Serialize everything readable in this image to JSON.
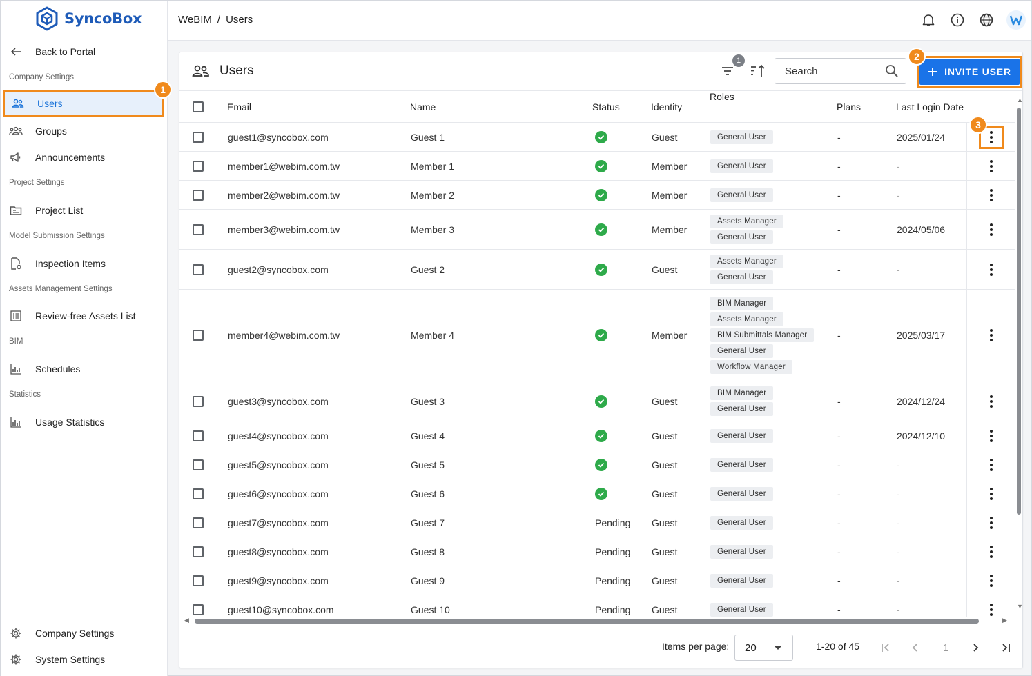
{
  "app": {
    "name": "SyncoBox"
  },
  "sidebar": {
    "back_label": "Back to Portal",
    "sections": {
      "company": "Company Settings",
      "project": "Project Settings",
      "model": "Model Submission Settings",
      "assets": "Assets Management Settings",
      "bim": "BIM",
      "stats": "Statistics"
    },
    "items": {
      "users": "Users",
      "groups": "Groups",
      "announcements": "Announcements",
      "project_list": "Project List",
      "inspection_items": "Inspection Items",
      "review_free": "Review-free Assets List",
      "schedules": "Schedules",
      "usage_statistics": "Usage Statistics"
    },
    "bottom": {
      "company_settings": "Company Settings",
      "system_settings": "System Settings"
    }
  },
  "breadcrumb": {
    "root": "WeBIM",
    "sep": "/",
    "current": "Users"
  },
  "annotations": [
    "1",
    "2",
    "3"
  ],
  "page": {
    "title": "Users",
    "filter_count": "1",
    "search_placeholder": "Search",
    "invite_label": "INVITE USER"
  },
  "table": {
    "headers": {
      "email": "Email",
      "name": "Name",
      "status": "Status",
      "identity": "Identity",
      "roles": "Roles",
      "plans": "Plans",
      "last_login": "Last Login Date"
    },
    "rows": [
      {
        "email": "guest1@syncobox.com",
        "name": "Guest 1",
        "status": "active",
        "identity": "Guest",
        "roles": [
          "General User"
        ],
        "plans": "-",
        "last_login": "2025/01/24"
      },
      {
        "email": "member1@webim.com.tw",
        "name": "Member 1",
        "status": "active",
        "identity": "Member",
        "roles": [
          "General User"
        ],
        "plans": "-",
        "last_login": "-"
      },
      {
        "email": "member2@webim.com.tw",
        "name": "Member 2",
        "status": "active",
        "identity": "Member",
        "roles": [
          "General User"
        ],
        "plans": "-",
        "last_login": "-"
      },
      {
        "email": "member3@webim.com.tw",
        "name": "Member 3",
        "status": "active",
        "identity": "Member",
        "roles": [
          "Assets Manager",
          "General User"
        ],
        "plans": "-",
        "last_login": "2024/05/06"
      },
      {
        "email": "guest2@syncobox.com",
        "name": "Guest 2",
        "status": "active",
        "identity": "Guest",
        "roles": [
          "Assets Manager",
          "General User"
        ],
        "plans": "-",
        "last_login": "-"
      },
      {
        "email": "member4@webim.com.tw",
        "name": "Member 4",
        "status": "active",
        "identity": "Member",
        "roles": [
          "BIM Manager",
          "Assets Manager",
          "BIM Submittals Manager",
          "General User",
          "Workflow Manager"
        ],
        "plans": "-",
        "last_login": "2025/03/17"
      },
      {
        "email": "guest3@syncobox.com",
        "name": "Guest 3",
        "status": "active",
        "identity": "Guest",
        "roles": [
          "BIM Manager",
          "General User"
        ],
        "plans": "-",
        "last_login": "2024/12/24"
      },
      {
        "email": "guest4@syncobox.com",
        "name": "Guest 4",
        "status": "active",
        "identity": "Guest",
        "roles": [
          "General User"
        ],
        "plans": "-",
        "last_login": "2024/12/10"
      },
      {
        "email": "guest5@syncobox.com",
        "name": "Guest 5",
        "status": "active",
        "identity": "Guest",
        "roles": [
          "General User"
        ],
        "plans": "-",
        "last_login": "-"
      },
      {
        "email": "guest6@syncobox.com",
        "name": "Guest 6",
        "status": "active",
        "identity": "Guest",
        "roles": [
          "General User"
        ],
        "plans": "-",
        "last_login": "-"
      },
      {
        "email": "guest7@syncobox.com",
        "name": "Guest 7",
        "status": "Pending",
        "identity": "Guest",
        "roles": [
          "General User"
        ],
        "plans": "-",
        "last_login": "-"
      },
      {
        "email": "guest8@syncobox.com",
        "name": "Guest 8",
        "status": "Pending",
        "identity": "Guest",
        "roles": [
          "General User"
        ],
        "plans": "-",
        "last_login": "-"
      },
      {
        "email": "guest9@syncobox.com",
        "name": "Guest 9",
        "status": "Pending",
        "identity": "Guest",
        "roles": [
          "General User"
        ],
        "plans": "-",
        "last_login": "-"
      },
      {
        "email": "guest10@syncobox.com",
        "name": "Guest 10",
        "status": "Pending",
        "identity": "Guest",
        "roles": [
          "General User"
        ],
        "plans": "-",
        "last_login": "-"
      }
    ]
  },
  "pagination": {
    "items_per_page_label": "Items per page:",
    "items_per_page": "20",
    "range": "1-20 of 45",
    "page": "1"
  },
  "colors": {
    "brand": "#1e5bb8",
    "accent": "#1a73e8",
    "annotation": "#f08a1c",
    "success": "#2eaa4a"
  }
}
